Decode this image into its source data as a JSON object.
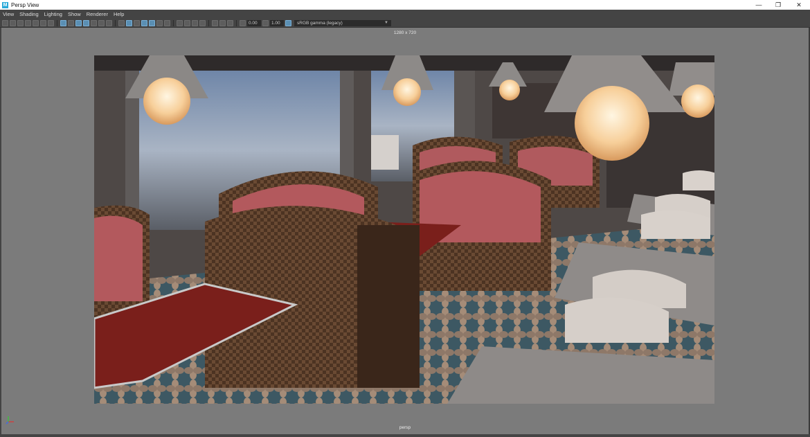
{
  "window": {
    "title": "Persp View",
    "app_icon_letter": "M",
    "minimize": "—",
    "maximize": "❐",
    "close": "✕"
  },
  "menu": [
    "View",
    "Shading",
    "Lighting",
    "Show",
    "Renderer",
    "Help"
  ],
  "toolbar": {
    "exposure": "0.00",
    "gamma": "1.00",
    "color_space": "sRGB gamma (legacy)"
  },
  "viewport": {
    "resolution_gate": "1280 x 720",
    "camera": "persp"
  }
}
